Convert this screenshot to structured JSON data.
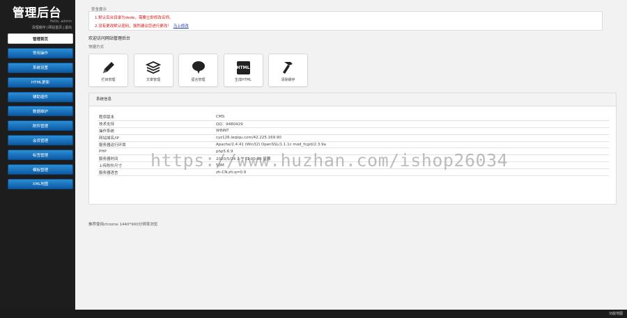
{
  "sidebar": {
    "logo": "管理后台",
    "hello": "Hello, admin",
    "links": [
      "清理缓存",
      "网站首页",
      "退出"
    ],
    "items": [
      {
        "label": "管理首页",
        "active": true
      },
      {
        "label": "常用操作"
      },
      {
        "label": "系统设置"
      },
      {
        "label": "HTML更新"
      },
      {
        "label": "辅助插件"
      },
      {
        "label": "数据维护"
      },
      {
        "label": "附件管理"
      },
      {
        "label": "会员管理"
      },
      {
        "label": "标签管理"
      },
      {
        "label": "模板管理"
      },
      {
        "label": "XML地图"
      }
    ]
  },
  "notice": {
    "title": "安全提示",
    "line1": "1.默认后台目录为dede，需要立即修改名称。",
    "line2": "2.没有更改默认密码，强烈建议您进行更改！",
    "line2_link": "马上修改"
  },
  "welcome": "欢迎访问网站管理后台",
  "quick": {
    "label": "快捷方式",
    "buttons": [
      {
        "label": "栏目管理",
        "icon": "pencil-icon"
      },
      {
        "label": "文章管理",
        "icon": "stack-icon"
      },
      {
        "label": "留言管理",
        "icon": "speech-bubble-icon"
      },
      {
        "label": "生成HTML",
        "icon": "html-icon",
        "icon_text": "HTML"
      },
      {
        "label": "清除缓存",
        "icon": "hammer-icon"
      }
    ]
  },
  "system": {
    "title": "系统信息",
    "rows": [
      {
        "k": "程序版本",
        "v": "CMS"
      },
      {
        "k": "技术支持",
        "v": "QQ：9480429"
      },
      {
        "k": "操作系统",
        "v": "WINNT"
      },
      {
        "k": "网站域名/IP",
        "v": "cyz126.leqiqu.com/42.225.169.90"
      },
      {
        "k": "服务器运行环境",
        "v": "Apache/2.4.41 (Win32) OpenSSL/1.1.1c mod_fcgid/2.3.9a"
      },
      {
        "k": "PHP",
        "v": "php5.6.9"
      },
      {
        "k": "服务器时间",
        "v": "2020/5/24 上午11:00:40 星期"
      },
      {
        "k": "上传附件尺寸",
        "v": "50M"
      },
      {
        "k": "服务器语言",
        "v": "zh-CN,zh;q=0.9"
      }
    ]
  },
  "browser_tip": "推荐使用chrome 1440*900分辨率浏览",
  "footer": "功能地图",
  "watermark": "https://www.huzhan.com/ishop26034"
}
